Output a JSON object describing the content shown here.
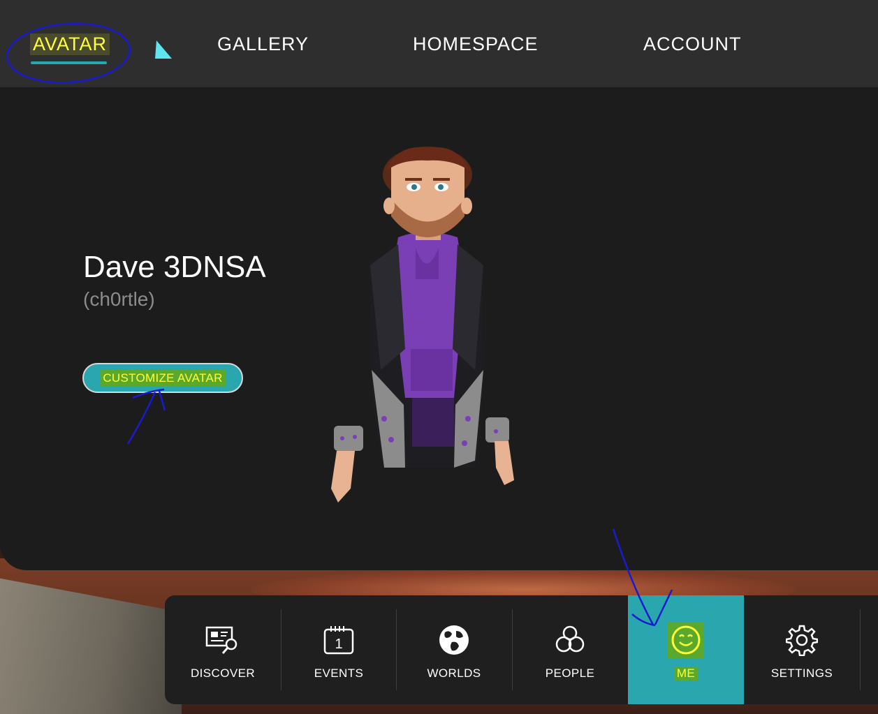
{
  "top_nav": {
    "tabs": [
      {
        "label": "AVATAR",
        "active": true
      },
      {
        "label": "GALLERY"
      },
      {
        "label": "HOMESPACE"
      },
      {
        "label": "ACCOUNT"
      }
    ]
  },
  "profile": {
    "display_name": "Dave 3DNSA",
    "username": "(ch0rtle)",
    "customize_button": "CUSTOMIZE AVATAR"
  },
  "dock": {
    "items": [
      {
        "label": "DISCOVER",
        "icon": "discover-icon"
      },
      {
        "label": "EVENTS",
        "icon": "calendar-icon",
        "icon_text": "1"
      },
      {
        "label": "WORLDS",
        "icon": "globe-icon"
      },
      {
        "label": "PEOPLE",
        "icon": "people-icon"
      },
      {
        "label": "ME",
        "icon": "smiley-icon",
        "active": true
      },
      {
        "label": "SETTINGS",
        "icon": "gear-icon"
      }
    ]
  },
  "colors": {
    "accent_teal": "#2aa6ae",
    "highlight_yellow": "#ffff3a",
    "highlight_green": "#5aa82c",
    "panel_bg": "#1c1c1c",
    "nav_bg": "#2e2e2e",
    "annotation_blue": "#1a1ad0"
  }
}
